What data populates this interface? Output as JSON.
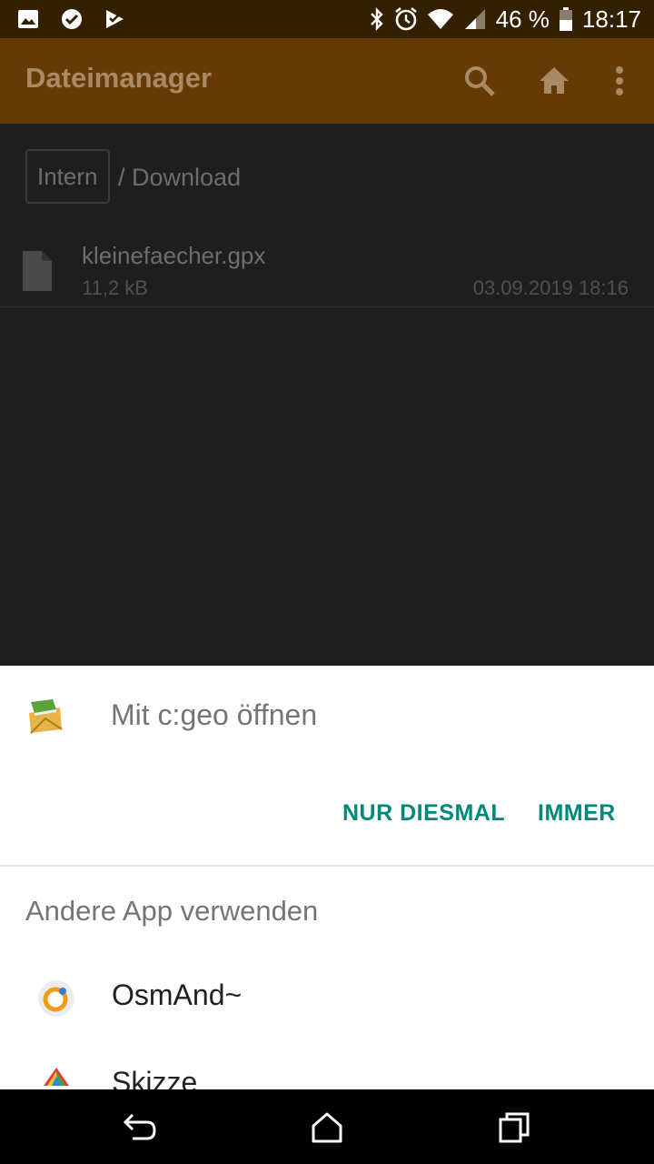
{
  "status_bar": {
    "battery": "46 %",
    "time": "18:17",
    "icons": [
      "image-icon",
      "check-circle-icon",
      "play-check-icon",
      "bluetooth-icon",
      "alarm-icon",
      "wifi-icon",
      "signal-icon",
      "battery-icon"
    ]
  },
  "app_bar": {
    "title": "Dateimanager",
    "icons": [
      "search-icon",
      "home-icon",
      "overflow-menu-icon"
    ],
    "color": "#663a04"
  },
  "breadcrumb": {
    "root": "Intern",
    "path": "/ Download"
  },
  "files": [
    {
      "name": "kleinefaecher.gpx",
      "size": "11,2 kB",
      "date": "03.09.2019 18:16",
      "icon": "file-icon"
    }
  ],
  "chooser": {
    "title": "Mit c:geo öffnen",
    "icon": "cgeo-app-icon",
    "once_label": "NUR DIESMAL",
    "always_label": "IMMER",
    "accent": "#00897b",
    "other_title": "Andere App verwenden",
    "apps": [
      {
        "label": "OsmAnd~",
        "icon": "osmand-app-icon"
      },
      {
        "label": "Skizze",
        "icon": "skizze-app-icon"
      }
    ]
  },
  "nav_bar": {
    "icons": [
      "back-icon",
      "home-nav-icon",
      "recents-icon"
    ]
  }
}
